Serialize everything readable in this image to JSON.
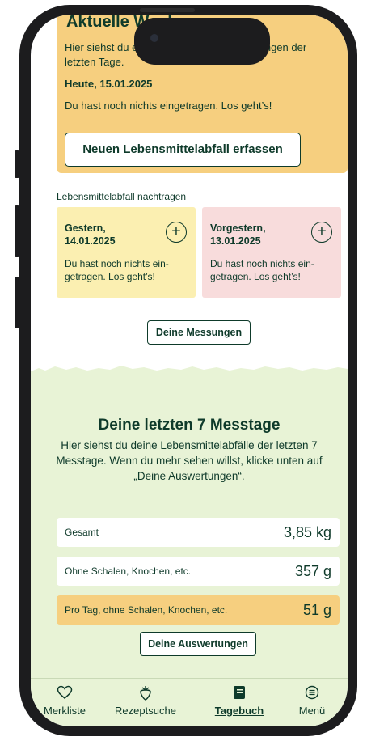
{
  "today": {
    "title": "Aktuelle Woche",
    "intro": "Hier siehst du eine Übersicht deiner Messungen der letzten Tage.",
    "date": "Heute, 15.01.2025",
    "empty": "Du hast noch nichts eingetragen. Los geht’s!",
    "button": "Neuen Lebensmittelabfall erfassen"
  },
  "backfill": {
    "label": "Lebensmittelabfall nachtragen",
    "days": [
      {
        "date_line1": "Gestern,",
        "date_line2": "14.01.2025",
        "text": "Du hast noch nichts ein-getragen. Los geht’s!",
        "color": "#fbefb1"
      },
      {
        "date_line1": "Vorgestern,",
        "date_line2": "13.01.2025",
        "text": "Du hast noch nichts ein-getragen. Los geht’s!",
        "color": "#f8dcdc"
      }
    ],
    "plus_icon": "+"
  },
  "messungen_button": "Deine Messungen",
  "stats": {
    "title": "Deine letzten 7 Messtage",
    "subtitle": "Hier siehst du deine Lebensmittelabfälle der letzten 7 Messtage. Wenn du mehr sehen willst, klicke unten auf „Deine Auswertungen“.",
    "rows": [
      {
        "label": "Gesamt",
        "value": "3,85 kg"
      },
      {
        "label": "Ohne Schalen, Knochen, etc.",
        "value": "357 g"
      },
      {
        "label": "Pro Tag, ohne Schalen, Knochen, etc.",
        "value": "51 g"
      }
    ],
    "button": "Deine Auswertungen"
  },
  "nav": {
    "items": [
      {
        "label": "Merkliste",
        "icon": "heart-icon"
      },
      {
        "label": "Rezeptsuche",
        "icon": "strawberry-icon"
      },
      {
        "label": "Tagebuch",
        "icon": "book-icon"
      },
      {
        "label": "Menü",
        "icon": "menu-icon"
      }
    ],
    "active": "Tagebuch"
  },
  "colors": {
    "dark_green": "#0e3a2a",
    "yellow": "#f6cf7f",
    "light_green": "#e8f3d6"
  }
}
